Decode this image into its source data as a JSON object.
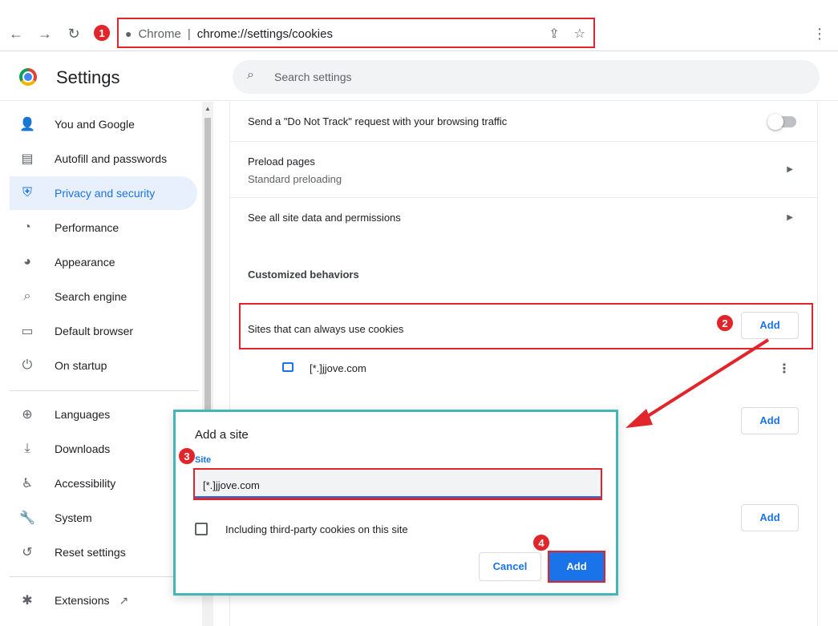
{
  "browser": {
    "site_name": "Chrome",
    "url": "chrome://settings/cookies"
  },
  "header": {
    "title": "Settings",
    "search_placeholder": "Search settings"
  },
  "sidebar": {
    "items": [
      {
        "label": "You and Google",
        "icon": "person-icon",
        "glyph": "👤"
      },
      {
        "label": "Autofill and passwords",
        "icon": "clipboard-icon",
        "glyph": "▤"
      },
      {
        "label": "Privacy and security",
        "icon": "shield-icon",
        "glyph": "⛨",
        "active": true
      },
      {
        "label": "Performance",
        "icon": "gauge-icon",
        "glyph": "◔"
      },
      {
        "label": "Appearance",
        "icon": "palette-icon",
        "glyph": "◕"
      },
      {
        "label": "Search engine",
        "icon": "search-icon",
        "glyph": "⌕"
      },
      {
        "label": "Default browser",
        "icon": "browser-icon",
        "glyph": "▭"
      },
      {
        "label": "On startup",
        "icon": "power-icon",
        "glyph": "⏻"
      },
      {
        "label": "Languages",
        "icon": "globe-icon",
        "glyph": "⊕"
      },
      {
        "label": "Downloads",
        "icon": "download-icon",
        "glyph": "⤓"
      },
      {
        "label": "Accessibility",
        "icon": "accessibility-icon",
        "glyph": "♿"
      },
      {
        "label": "System",
        "icon": "wrench-icon",
        "glyph": "🔧"
      },
      {
        "label": "Reset settings",
        "icon": "reset-icon",
        "glyph": "↺"
      },
      {
        "label": "Extensions",
        "icon": "puzzle-icon",
        "glyph": "✱"
      }
    ],
    "extensions_external_icon": "↗"
  },
  "main": {
    "dnt_label": "Send a \"Do Not Track\" request with your browsing traffic",
    "preload_label": "Preload pages",
    "preload_sub": "Standard preloading",
    "site_data_label": "See all site data and permissions",
    "customized_heading": "Customized behaviors",
    "always_cookies_label": "Sites that can always use cookies",
    "add_label": "Add",
    "site_entry": "[*.]jjove.com"
  },
  "dialog": {
    "title": "Add a site",
    "field_label": "Site",
    "field_value": "[*.]jjove.com",
    "checkbox_label": "Including third-party cookies on this site",
    "cancel_label": "Cancel",
    "add_label": "Add"
  },
  "annotations": {
    "step1": "1",
    "step2": "2",
    "step3": "3",
    "step4": "4",
    "color": "#e0262b"
  }
}
